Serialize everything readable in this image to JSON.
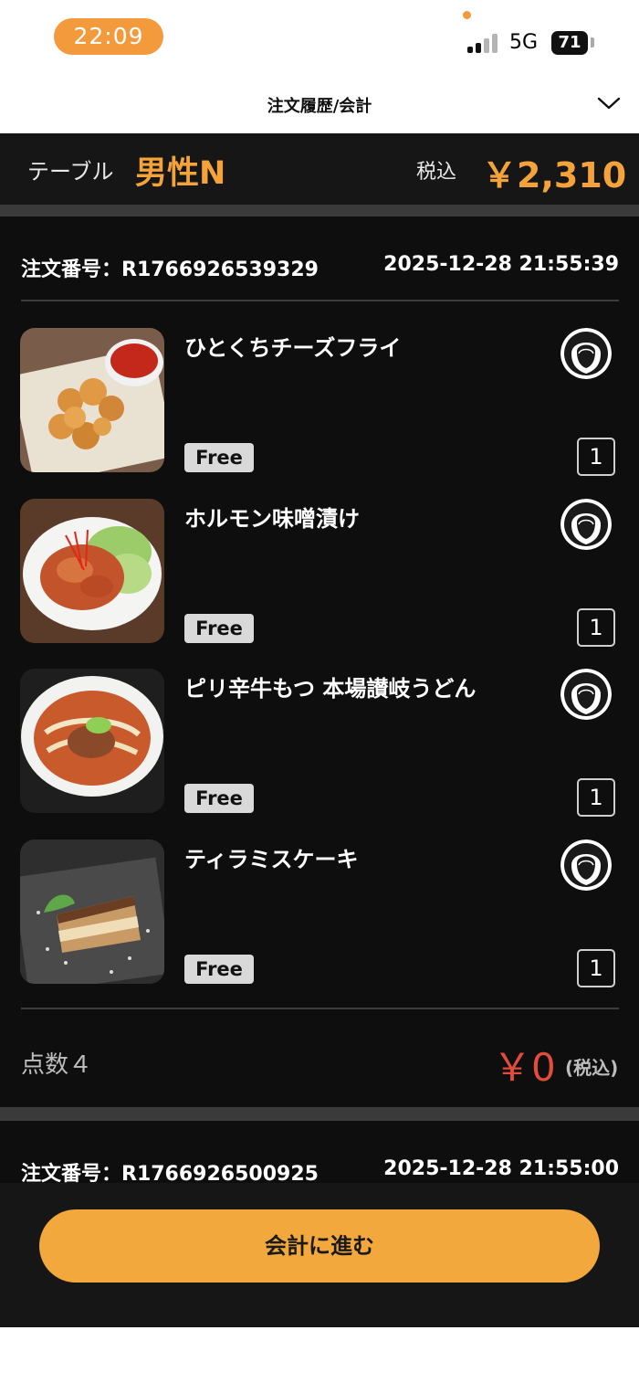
{
  "status_bar": {
    "time": "22:09",
    "network": "5G",
    "battery": "71"
  },
  "header": {
    "title": "注文履歴/会計"
  },
  "table": {
    "label": "テーブル",
    "name": "男性N",
    "tax_label": "税込",
    "total": "￥2,310"
  },
  "orders": [
    {
      "order_number": "注文番号：R1766926539329",
      "datetime": "2025-12-28 21:55:39",
      "items": [
        {
          "name": "ひとくちチーズフライ",
          "badge": "Free",
          "quantity": "1",
          "image_icon": "cheese-fry-photo"
        },
        {
          "name": "ホルモン味噌漬け",
          "badge": "Free",
          "quantity": "1",
          "image_icon": "horumon-photo"
        },
        {
          "name": "ピリ辛牛もつ 本場讃岐うどん",
          "badge": "Free",
          "quantity": "1",
          "image_icon": "udon-photo"
        },
        {
          "name": "ティラミスケーキ",
          "badge": "Free",
          "quantity": "1",
          "image_icon": "tiramisu-photo"
        }
      ],
      "count_label": "点数４",
      "subtotal": "￥0",
      "subtotal_tax": "(税込)"
    },
    {
      "order_number": "注文番号：R1766926500925",
      "datetime": "2025-12-28 21:55:00"
    }
  ],
  "footer": {
    "checkout_label": "会計に進む"
  },
  "colors": {
    "accent": "#f4a33a",
    "price_red": "#e34b3a",
    "background": "#0e0e0e",
    "button": "#f2a83d"
  }
}
